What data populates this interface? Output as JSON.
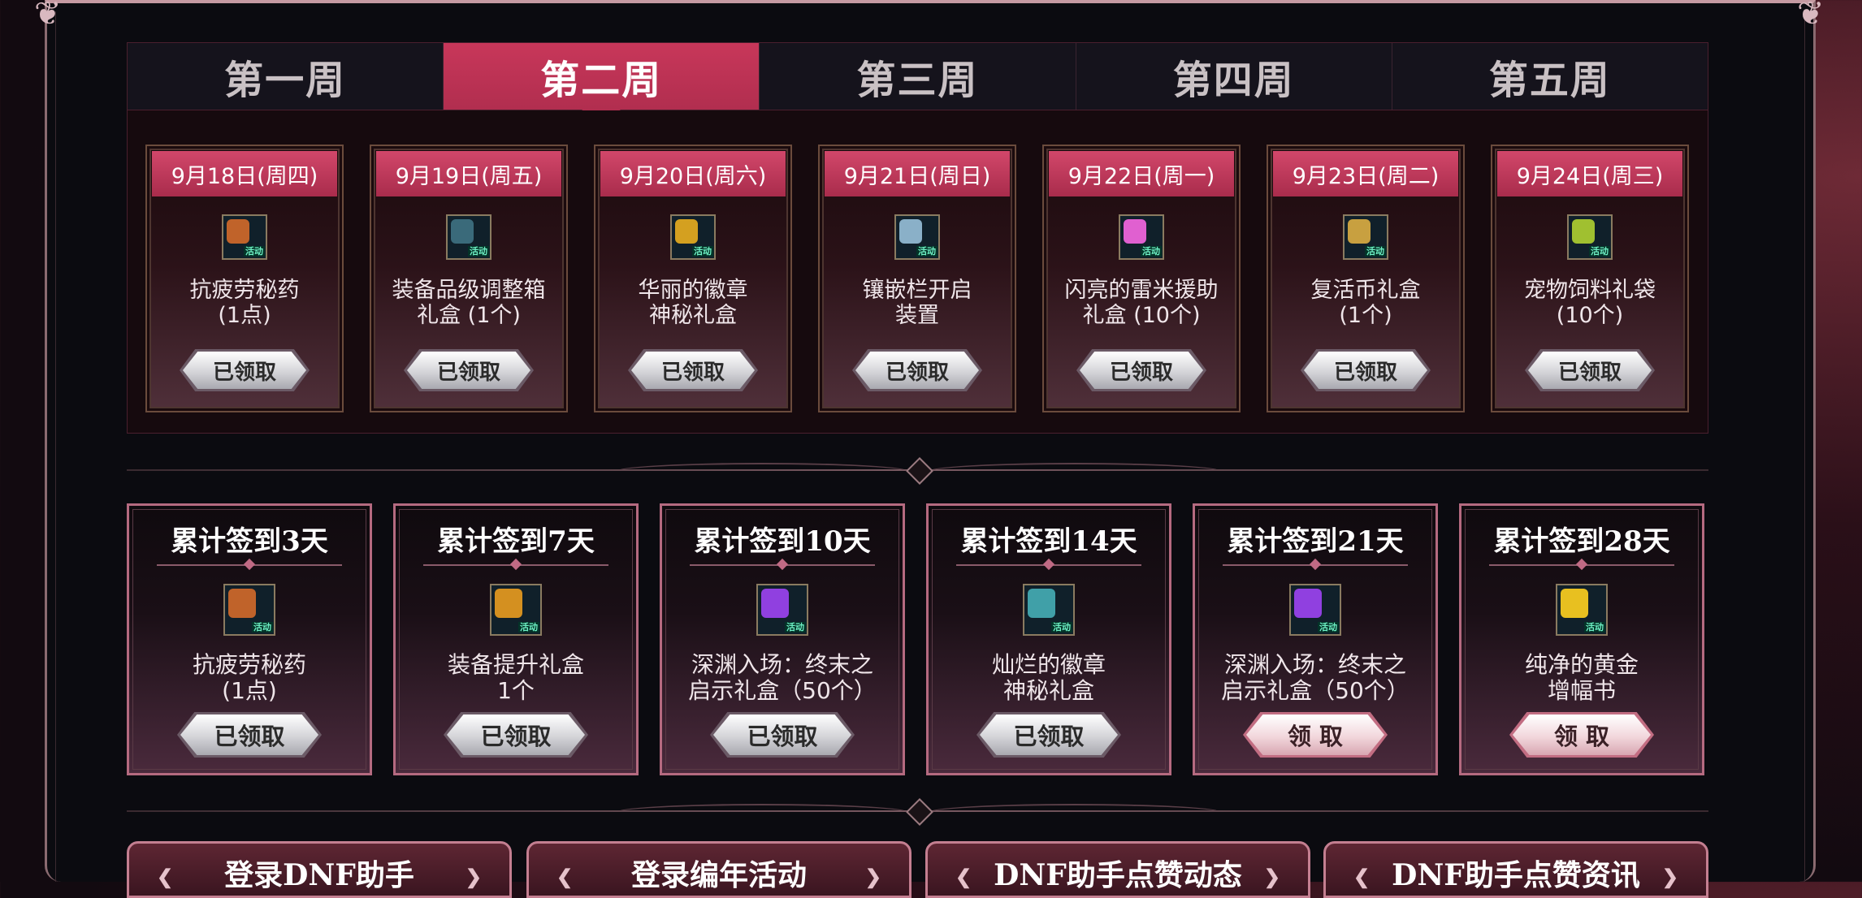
{
  "week_tabs": [
    {
      "label": "第一周",
      "active": false
    },
    {
      "label": "第二周",
      "active": true
    },
    {
      "label": "第三周",
      "active": false
    },
    {
      "label": "第四周",
      "active": false
    },
    {
      "label": "第五周",
      "active": false
    }
  ],
  "daily_rewards": [
    {
      "date": "9月18日(周四)",
      "name": "抗疲劳秘药\n(1点)",
      "status": "已领取",
      "icon": "potion-icon",
      "icon_tag": "活动",
      "color": "#c0632a"
    },
    {
      "date": "9月19日(周五)",
      "name": "装备品级调整箱\n礼盒 (1个)",
      "status": "已领取",
      "icon": "equipment-box-icon",
      "icon_tag": "活动",
      "color": "#3a6a7a"
    },
    {
      "date": "9月20日(周六)",
      "name": "华丽的徽章\n神秘礼盒",
      "status": "已领取",
      "icon": "gold-emblem-box-icon",
      "icon_tag": "活动",
      "color": "#d4a020"
    },
    {
      "date": "9月21日(周日)",
      "name": "镶嵌栏开启\n装置",
      "status": "已领取",
      "icon": "socket-device-icon",
      "icon_tag": "活动",
      "color": "#8ab0c8"
    },
    {
      "date": "9月22日(周一)",
      "name": "闪亮的雷米援助\n礼盒 (10个)",
      "status": "已领取",
      "icon": "sparkle-box-icon",
      "icon_tag": "活动",
      "color": "#e060d0"
    },
    {
      "date": "9月23日(周二)",
      "name": "复活币礼盒\n(1个)",
      "status": "已领取",
      "icon": "revive-coin-icon",
      "icon_tag": "活动",
      "color": "#c8a040"
    },
    {
      "date": "9月24日(周三)",
      "name": "宠物饲料礼袋\n(10个)",
      "status": "已领取",
      "icon": "pet-food-icon",
      "icon_tag": "活动",
      "color": "#a0c030"
    }
  ],
  "cumulative_rewards": [
    {
      "title": "累计签到3天",
      "name": "抗疲劳秘药\n(1点)",
      "status": "已领取",
      "claimable": false,
      "icon": "potion-icon",
      "icon_tag": "活动",
      "color": "#c0632a"
    },
    {
      "title": "累计签到7天",
      "name": "装备提升礼盒\n1个",
      "status": "已领取",
      "claimable": false,
      "icon": "gold-box-icon",
      "icon_tag": "活动",
      "color": "#d49020"
    },
    {
      "title": "累计签到10天",
      "name": "深渊入场：终末之\n启示礼盒（50个）",
      "status": "已领取",
      "claimable": false,
      "icon": "abyss-ticket-icon",
      "icon_tag": "活动",
      "color": "#9040e0"
    },
    {
      "title": "累计签到14天",
      "name": "灿烂的徽章\n神秘礼盒",
      "status": "已领取",
      "claimable": false,
      "icon": "brilliant-emblem-box-icon",
      "icon_tag": "活动",
      "color": "#40a0a8"
    },
    {
      "title": "累计签到21天",
      "name": "深渊入场：终末之\n启示礼盒（50个）",
      "status": "领 取",
      "claimable": true,
      "icon": "abyss-ticket-icon",
      "icon_tag": "活动",
      "color": "#9040e0"
    },
    {
      "title": "累计签到28天",
      "name": "纯净的黄金\n增幅书",
      "status": "领 取",
      "claimable": true,
      "icon": "gold-amplify-book-icon",
      "icon_tag": "活动",
      "color": "#e8c020"
    }
  ],
  "bottom_buttons": [
    {
      "label": "登录DNF助手"
    },
    {
      "label": "登录编年活动"
    },
    {
      "label": "DNF助手点赞动态"
    },
    {
      "label": "DNF助手点赞资讯"
    }
  ],
  "colors": {
    "accent": "#c8375a",
    "card_border": "#b56a80",
    "frame": "#c59aa2"
  }
}
